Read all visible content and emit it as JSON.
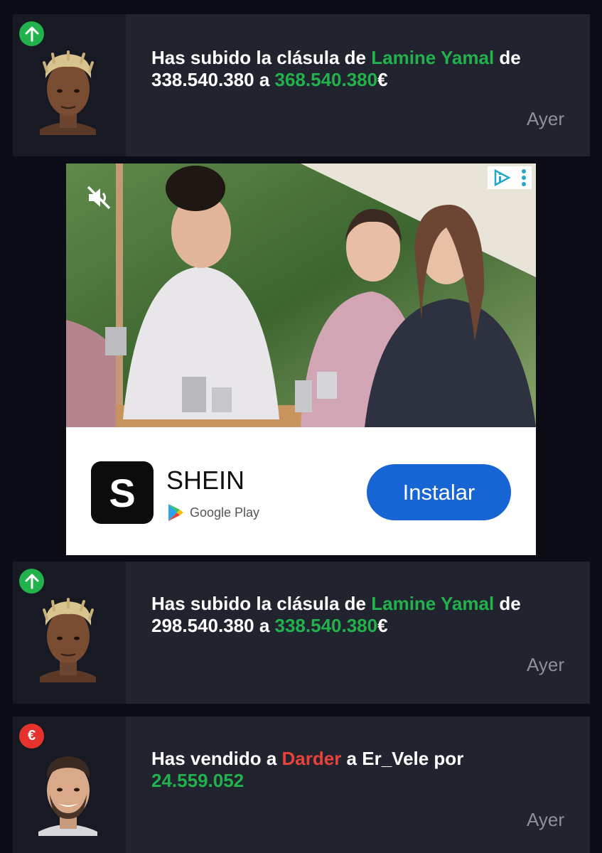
{
  "notifications": [
    {
      "type": "clause-raise",
      "badge_icon": "arrow-up-icon",
      "prefix": "Has subido la clásula de ",
      "player": "Lamine Yamal",
      "middle": " de",
      "from_value": "338.540.380",
      "connector": " a ",
      "to_value": "368.540.380",
      "currency": "€",
      "time": "Ayer"
    },
    {
      "type": "clause-raise",
      "badge_icon": "arrow-up-icon",
      "prefix": "Has subido la clásula de ",
      "player": "Lamine Yamal",
      "middle": " de",
      "from_value": "298.540.380",
      "connector": " a ",
      "to_value": "338.540.380",
      "currency": "€",
      "time": "Ayer"
    },
    {
      "type": "sale",
      "badge_icon": "euro-icon",
      "badge_text": "€",
      "prefix": "Has vendido a ",
      "player": "Darder",
      "middle": " a Er_Vele por",
      "amount": "24.559.052",
      "time": "Ayer"
    }
  ],
  "ad": {
    "app_name": "SHEIN",
    "app_icon_letter": "S",
    "store": "Google Play",
    "cta": "Instalar"
  },
  "colors": {
    "background": "#0b0c16",
    "card": "#21232f",
    "card_left": "#171923",
    "accent_green": "#22b24c",
    "accent_red": "#e8423a",
    "cta_blue": "#1765d4"
  }
}
